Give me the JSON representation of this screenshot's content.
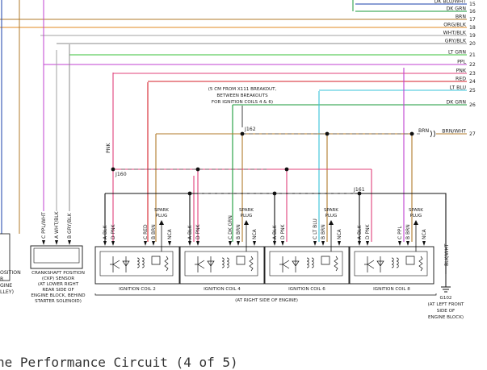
{
  "wires": [
    {
      "label": "DK BLU/WHT",
      "num": "15",
      "color": "#1a3fa8"
    },
    {
      "label": "DK GRN",
      "num": "16",
      "color": "#1a9a3a"
    },
    {
      "label": "BRN",
      "num": "17",
      "color": "#b07a2a"
    },
    {
      "label": "ORG/BLK",
      "num": "18",
      "color": "#e08a20"
    },
    {
      "label": "WHT/BLK",
      "num": "19",
      "color": "#a0a0a0"
    },
    {
      "label": "GRY/BLK",
      "num": "20",
      "color": "#8a8a8a"
    },
    {
      "label": "LT GRN",
      "num": "21",
      "color": "#39c23a"
    },
    {
      "label": "PPL",
      "num": "22",
      "color": "#c040d0"
    },
    {
      "label": "PNK",
      "num": "23",
      "color": "#e0407a"
    },
    {
      "label": "RED",
      "num": "24",
      "color": "#d41f2a"
    },
    {
      "label": "LT BLU",
      "num": "25",
      "color": "#37c3d8"
    },
    {
      "label": "DK GRN",
      "num": "26",
      "color": "#1a9a3a"
    },
    {
      "label": "BRN/WHT",
      "num": "27",
      "color": "#b07a2a"
    }
  ],
  "wire27_inline": "BRN",
  "notes": {
    "breakout": [
      "(5 CM FROM X111 BREAKOUT,",
      "BETWEEN BREAKOUTS",
      "FOR IGNITION COILS 4 & 6)"
    ],
    "pnk_vertical": "PNK",
    "j162": "J162",
    "j160": "J160",
    "j161": "J161"
  },
  "left_sensor": [
    "OSITION",
    "R",
    "GINE",
    "LLEY)"
  ],
  "ckp": {
    "pins": [
      "C  PPL/WHT",
      "A  WHT/BLK",
      "B  GRY/BLK"
    ],
    "label": [
      "CRANKSHAFT POSITION",
      "(CKP) SENSOR",
      "(AT LOWER RIGHT",
      "REAR SIDE OF",
      "ENGINE BLOCK, BEHIND",
      "STARTER SOLENOID)"
    ]
  },
  "coils": [
    {
      "name": "IGNITION COIL 2",
      "pins": [
        "A  BLK",
        "D  PNK",
        "C  RED",
        "B  BRN",
        "NCA"
      ],
      "spark": [
        "SPARK",
        "PLUG"
      ]
    },
    {
      "name": "IGNITION COIL 4",
      "pins": [
        "A  BLK",
        "D  PNK",
        "C  DK GRN",
        "B  BRN",
        "NCA"
      ],
      "spark": [
        "SPARK",
        "PLUG"
      ]
    },
    {
      "name": "IGNITION COIL 6",
      "pins": [
        "A  BLK",
        "D  PNK",
        "C  LT BLU",
        "B  BRN",
        "NCA"
      ],
      "spark": [
        "SPARK",
        "PLUG"
      ]
    },
    {
      "name": "IGNITION COIL 8",
      "pins": [
        "A  BLK",
        "D  PNK",
        "C  PPL",
        "B  BRN",
        "NCA"
      ],
      "spark": [
        "SPARK",
        "PLUG"
      ]
    }
  ],
  "engine_side": "(AT RIGHT SIDE OF ENGINE)",
  "ground": {
    "wire": "BLK/WHT",
    "name": "G102",
    "location": [
      "(AT LEFT FRONT",
      "SIDE OF",
      "ENGINE BLOCK)"
    ]
  },
  "caption": "ne Performance Circuit (4 of 5)"
}
